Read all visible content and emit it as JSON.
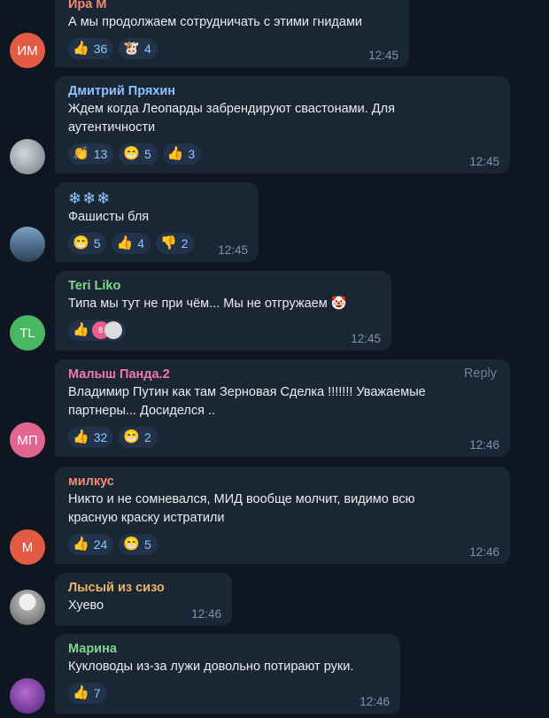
{
  "messages": [
    {
      "name": "Ира М",
      "name_color": "#f28c6f",
      "avatar_initials": "ИМ",
      "avatar_color": "#e45b44",
      "text": "А мы продолжаем сотрудничать с этими гнидами",
      "reactions": [
        {
          "icon": "thumbs-up-icon",
          "glyph": "👍",
          "count": "36"
        },
        {
          "icon": "cow-face-icon",
          "glyph": "🐮",
          "count": "4"
        }
      ],
      "time": "12:45"
    },
    {
      "name": "Дмитрий Пряхин",
      "name_color": "#8ec2ff",
      "avatar_color": "#8a939c",
      "text_line1": "Ждем когда Леопарды забрендируют свастонами. Для",
      "text_line2": "аутентичности",
      "reactions": [
        {
          "icon": "clapping-hands-icon",
          "glyph": "👏",
          "count": "13"
        },
        {
          "icon": "grinning-face-icon",
          "glyph": "😁",
          "count": "5"
        },
        {
          "icon": "thumbs-up-icon",
          "glyph": "👍",
          "count": "3"
        }
      ],
      "time": "12:45"
    },
    {
      "emojis": "❄❄❄",
      "text": "Фашисты бля",
      "avatar_color": "#4d6a86",
      "reactions": [
        {
          "icon": "grinning-face-icon",
          "glyph": "😁",
          "count": "5"
        },
        {
          "icon": "thumbs-up-icon",
          "glyph": "👍",
          "count": "4"
        },
        {
          "icon": "thumbs-down-icon",
          "glyph": "👎",
          "count": "2"
        }
      ],
      "time": "12:45"
    },
    {
      "name": "Teri Liko",
      "name_color": "#7fd98a",
      "avatar_initials": "TL",
      "avatar_color": "#49b662",
      "text": "Типа мы тут не при чём... Мы не отгружаем 🤡",
      "reactions": [
        {
          "icon": "thumbs-up-icon",
          "glyph": "👍"
        }
      ],
      "reactor_badge": "8",
      "time": "12:45"
    },
    {
      "name": "Малыш Панда.2",
      "name_color": "#f07aa6",
      "reply_label": "Reply",
      "avatar_initials": "МП",
      "avatar_color": "#e2668f",
      "text_line1": "Владимир Путин как там Зерновая Сделка !!!!!!! Уважаемые",
      "text_line2": "партнеры...  Досиделся ..",
      "reactions": [
        {
          "icon": "thumbs-up-icon",
          "glyph": "👍",
          "count": "32"
        },
        {
          "icon": "grinning-face-icon",
          "glyph": "😁",
          "count": "2"
        }
      ],
      "time": "12:46"
    },
    {
      "name": "милкус",
      "name_color": "#f28c6f",
      "avatar_initials": "М",
      "avatar_color": "#e45b44",
      "text_line1": "Никто и не сомневался, МИД вообще молчит, видимо всю",
      "text_line2": "красную краску истратили",
      "reactions": [
        {
          "icon": "thumbs-up-icon",
          "glyph": "👍",
          "count": "24"
        },
        {
          "icon": "grinning-face-icon",
          "glyph": "😁",
          "count": "5"
        }
      ],
      "time": "12:46"
    },
    {
      "name": "Лысый из сизо",
      "name_color": "#e9b46b",
      "avatar_color": "#c9c9c9",
      "text": "Хуево",
      "time": "12:46"
    },
    {
      "name": "Марина",
      "name_color": "#7fd98a",
      "avatar_color": "#6a3fa0",
      "text": "Кукловоды из-за лужи довольно потирают руки.",
      "reactions": [
        {
          "icon": "thumbs-up-icon",
          "glyph": "👍",
          "count": "7"
        }
      ],
      "time": "12:46"
    }
  ]
}
